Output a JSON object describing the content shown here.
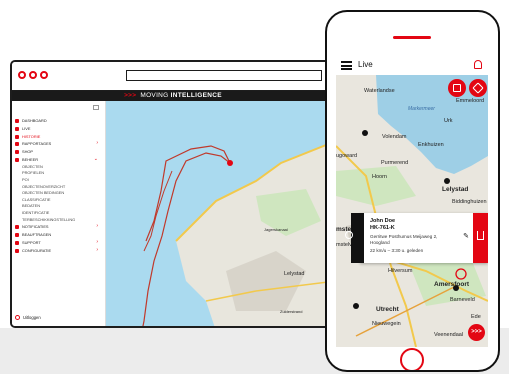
{
  "brand": {
    "prefix": ">>>",
    "word1": "MOVING",
    "word2": "INTELLIGENCE"
  },
  "sidebar": {
    "items": [
      {
        "label": "DASHBOARD",
        "icon": "dashboard-icon"
      },
      {
        "label": "LIVE",
        "icon": "location-pin-icon"
      },
      {
        "label": "HISTORIE",
        "icon": "history-icon",
        "active": true
      },
      {
        "label": "RAPPORTAGES",
        "icon": "reports-icon",
        "arrow": ">"
      },
      {
        "label": "SHOP",
        "icon": "cart-icon"
      },
      {
        "label": "BEHEER",
        "icon": "car-icon",
        "arrow": "v"
      }
    ],
    "subitems": [
      "OBJECTEN",
      "PROFIELEN",
      "POI",
      "OBJECTENOVERZICHT",
      "OBJECTEN BEDINGEN",
      "CLASSIFICATIE",
      "BEDATEN",
      "IDENTIFICATIE",
      "TERBESCHIKKINGSTELLING"
    ],
    "items2": [
      {
        "label": "NOTIFICATIES",
        "icon": "bell-icon",
        "arrow": ">"
      },
      {
        "label": "BEAUFTRAGEN",
        "icon": "key-icon"
      },
      {
        "label": "SUPPORT",
        "icon": "headset-icon",
        "arrow": ">"
      },
      {
        "label": "CONFIGURATIE",
        "icon": "gear-icon",
        "arrow": ">"
      }
    ],
    "logout": "Uitloggen"
  },
  "desktop_map": {
    "labels": [
      "Lelystad",
      "Jagerskanaal",
      "Zuiderstrand",
      "Nieuw Lelystad",
      "Batavia Stad",
      "Batavia Haven",
      "Lelystad-Haven"
    ]
  },
  "phone": {
    "title": "Live",
    "icons": {
      "menu": "hamburger-icon",
      "bell": "bell-icon",
      "list": "list-icon",
      "layers": "layers-icon"
    },
    "map_labels": {
      "waterland": "Waterlandse",
      "volendam": "Volendam",
      "edam": "Edam",
      "markermeer": "Markermeer",
      "purmerend": "Purmerend",
      "enkhuizen": "Enkhuizen",
      "hoorn": "Hoorn",
      "lelystad": "Lelystad",
      "emmeloord": "Emmeloord",
      "urk": "Urk",
      "biddinghuizen": "Biddinghuizen",
      "amsterdam": "msterda",
      "amstelveen": "mstelveer",
      "hilversum": "Hilversum",
      "amersfoort": "Amersfoort",
      "barneveld": "Barneveld",
      "utrecht": "Utrecht",
      "nieuwegein": "Nieuwegein",
      "ede": "Ede",
      "veenendaal": "Veenendaal",
      "ijsselmeer": "Ijsselmeer",
      "oegoward": "ugoward"
    },
    "card": {
      "name": "John Doe",
      "plate": "HK-761-K",
      "address1": "Gerritwe Posthumus Meijaweg 2,",
      "address2": "Hoogland",
      "speed": "22 km/u – 3:30 u. geleden"
    },
    "fwd": ">>>"
  }
}
